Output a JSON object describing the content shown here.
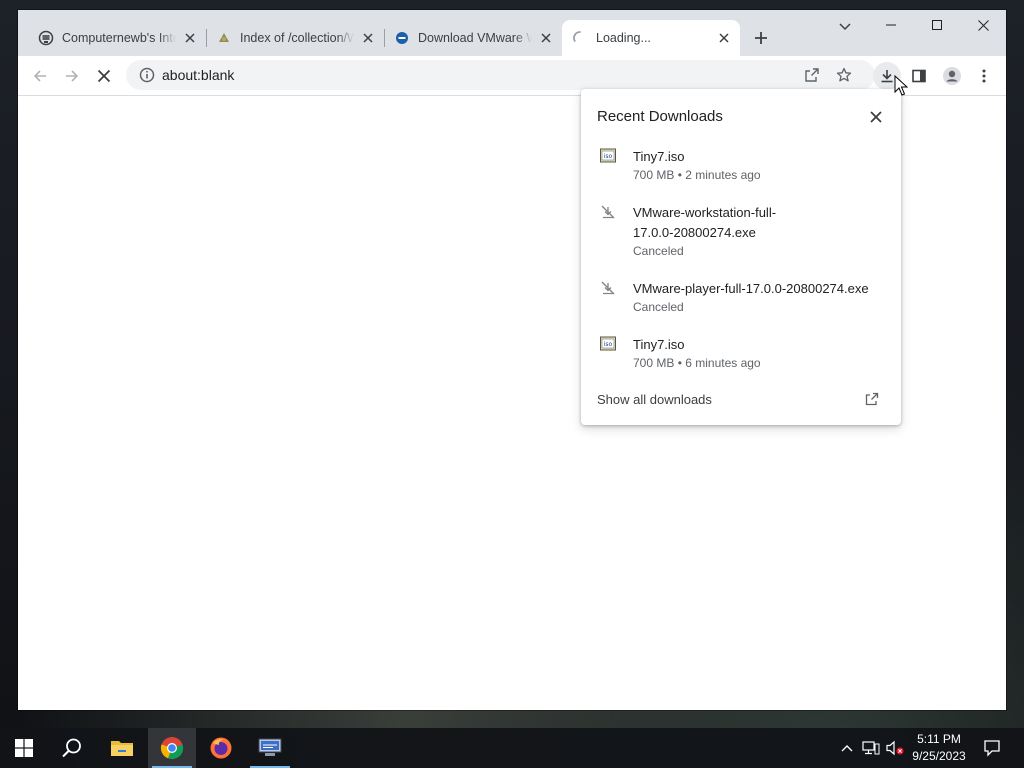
{
  "browser": {
    "tabs": [
      {
        "title": "Computernewb's Internet Archive",
        "favicon": "computernewb-favicon"
      },
      {
        "title": "Index of /collection/Windows",
        "favicon": "folder-favicon"
      },
      {
        "title": "Download VMware Workstation",
        "favicon": "vmware-favicon"
      },
      {
        "title": "Loading...",
        "favicon": "loading-spinner-icon"
      }
    ],
    "address": "about:blank"
  },
  "downloads": {
    "title": "Recent Downloads",
    "items": [
      {
        "name": "Tiny7.iso",
        "status": "700 MB • 2 minutes ago",
        "icon": "iso-file-icon"
      },
      {
        "name": "VMware-workstation-full-17.0.0-20800274.exe",
        "status": "Canceled",
        "icon": "canceled-download-icon"
      },
      {
        "name": "VMware-player-full-17.0.0-20800274.exe",
        "status": "Canceled",
        "icon": "canceled-download-icon"
      },
      {
        "name": "Tiny7.iso",
        "status": "700 MB • 6 minutes ago",
        "icon": "iso-file-icon"
      }
    ],
    "show_all": "Show all downloads"
  },
  "taskbar": {
    "apps": [
      "start",
      "search",
      "file-explorer",
      "chrome",
      "firefox",
      "network-app"
    ],
    "clock": {
      "time": "5:11 PM",
      "date": "9/25/2023"
    }
  },
  "colors": {
    "tabstrip": "#dee1e6",
    "omnibox": "#f1f3f4",
    "taskbar": "#121418",
    "taskbar_accent": "#76b9ed"
  }
}
